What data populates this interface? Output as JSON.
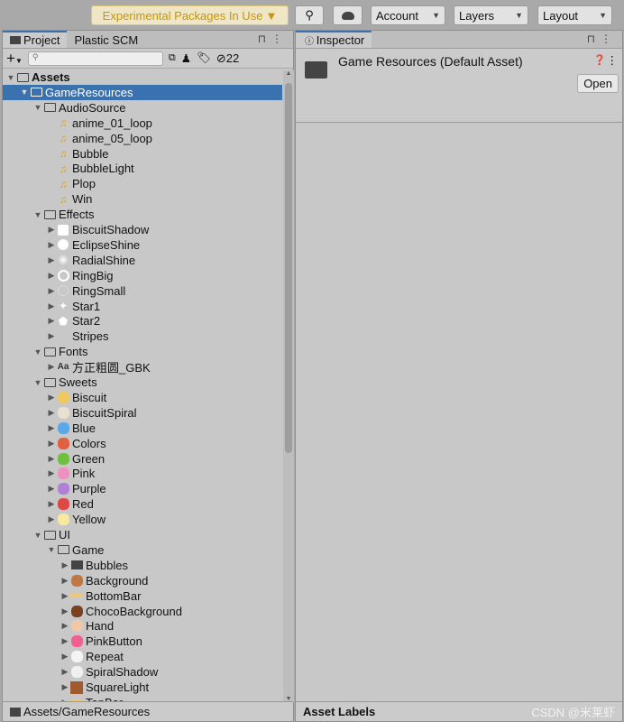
{
  "toolbar": {
    "experimental": "Experimental Packages In Use",
    "account": "Account",
    "layers": "Layers",
    "layout": "Layout"
  },
  "project": {
    "tabs": [
      "Project",
      "Plastic SCM"
    ],
    "hidden_count": "22",
    "path": "Assets/GameResources",
    "tree": [
      {
        "label": "Assets",
        "level": 0,
        "arrow": "open",
        "icon": "folder",
        "bold": true
      },
      {
        "label": "GameResources",
        "level": 1,
        "arrow": "open",
        "icon": "folder",
        "selected": true
      },
      {
        "label": "AudioSource",
        "level": 2,
        "arrow": "open",
        "icon": "folder"
      },
      {
        "label": "anime_01_loop",
        "level": 3,
        "arrow": "none",
        "icon": "audio"
      },
      {
        "label": "anime_05_loop",
        "level": 3,
        "arrow": "none",
        "icon": "audio"
      },
      {
        "label": "Bubble",
        "level": 3,
        "arrow": "none",
        "icon": "audio"
      },
      {
        "label": "BubbleLight",
        "level": 3,
        "arrow": "none",
        "icon": "audio"
      },
      {
        "label": "Plop",
        "level": 3,
        "arrow": "none",
        "icon": "audio"
      },
      {
        "label": "Win",
        "level": 3,
        "arrow": "none",
        "icon": "audio"
      },
      {
        "label": "Effects",
        "level": 2,
        "arrow": "open",
        "icon": "folder"
      },
      {
        "label": "BiscuitShadow",
        "level": 3,
        "arrow": "closed",
        "icon": "sprite-square"
      },
      {
        "label": "EclipseShine",
        "level": 3,
        "arrow": "closed",
        "icon": "sprite-circle"
      },
      {
        "label": "RadialShine",
        "level": 3,
        "arrow": "closed",
        "icon": "sprite-glow"
      },
      {
        "label": "RingBig",
        "level": 3,
        "arrow": "closed",
        "icon": "sprite-ring"
      },
      {
        "label": "RingSmall",
        "level": 3,
        "arrow": "closed",
        "icon": "sprite-faint"
      },
      {
        "label": "Star1",
        "level": 3,
        "arrow": "closed",
        "icon": "sprite-star"
      },
      {
        "label": "Star2",
        "level": 3,
        "arrow": "closed",
        "icon": "sprite-pentagon"
      },
      {
        "label": "Stripes",
        "level": 3,
        "arrow": "closed",
        "icon": "sprite-blank"
      },
      {
        "label": "Fonts",
        "level": 2,
        "arrow": "open",
        "icon": "folder"
      },
      {
        "label": "方正粗圆_GBK",
        "level": 3,
        "arrow": "closed",
        "icon": "font"
      },
      {
        "label": "Sweets",
        "level": 2,
        "arrow": "open",
        "icon": "folder"
      },
      {
        "label": "Biscuit",
        "level": 3,
        "arrow": "closed",
        "icon": "sweet",
        "color": "#f0c860"
      },
      {
        "label": "BiscuitSpiral",
        "level": 3,
        "arrow": "closed",
        "icon": "sweet",
        "color": "#e8e0d0"
      },
      {
        "label": "Blue",
        "level": 3,
        "arrow": "closed",
        "icon": "sweet",
        "color": "#5aa8e8"
      },
      {
        "label": "Colors",
        "level": 3,
        "arrow": "closed",
        "icon": "sweet",
        "color": "#e06040"
      },
      {
        "label": "Green",
        "level": 3,
        "arrow": "closed",
        "icon": "sweet",
        "color": "#70c040"
      },
      {
        "label": "Pink",
        "level": 3,
        "arrow": "closed",
        "icon": "sweet",
        "color": "#f090c0"
      },
      {
        "label": "Purple",
        "level": 3,
        "arrow": "closed",
        "icon": "sweet",
        "color": "#b080d8"
      },
      {
        "label": "Red",
        "level": 3,
        "arrow": "closed",
        "icon": "sweet",
        "color": "#e04848"
      },
      {
        "label": "Yellow",
        "level": 3,
        "arrow": "closed",
        "icon": "sweet",
        "color": "#f8e8a0"
      },
      {
        "label": "UI",
        "level": 2,
        "arrow": "open",
        "icon": "folder"
      },
      {
        "label": "Game",
        "level": 3,
        "arrow": "open",
        "icon": "folder"
      },
      {
        "label": "Bubbles",
        "level": 4,
        "arrow": "closed",
        "icon": "folder-closed"
      },
      {
        "label": "Background",
        "level": 4,
        "arrow": "closed",
        "icon": "sweet",
        "color": "#c07840"
      },
      {
        "label": "BottomBar",
        "level": 4,
        "arrow": "closed",
        "icon": "bar",
        "color": "#f0c878"
      },
      {
        "label": "ChocoBackground",
        "level": 4,
        "arrow": "closed",
        "icon": "sweet",
        "color": "#7a4020"
      },
      {
        "label": "Hand",
        "level": 4,
        "arrow": "closed",
        "icon": "sweet",
        "color": "#f0c8a8"
      },
      {
        "label": "PinkButton",
        "level": 4,
        "arrow": "closed",
        "icon": "sweet",
        "color": "#f06090"
      },
      {
        "label": "Repeat",
        "level": 4,
        "arrow": "closed",
        "icon": "sweet",
        "color": "#f4f4f4"
      },
      {
        "label": "SpiralShadow",
        "level": 4,
        "arrow": "closed",
        "icon": "sweet",
        "color": "#f0f0f0"
      },
      {
        "label": "SquareLight",
        "level": 4,
        "arrow": "closed",
        "icon": "square",
        "color": "#a05a30"
      },
      {
        "label": "TopBar",
        "level": 4,
        "arrow": "closed",
        "icon": "bar",
        "color": "#f0c878"
      }
    ]
  },
  "inspector": {
    "tab": "Inspector",
    "title": "Game Resources (Default Asset)",
    "open": "Open",
    "labels": "Asset Labels"
  },
  "colors": {
    "selection": "#3a72b0",
    "audio": "#d9a520",
    "experimental": "#c8950a"
  },
  "watermark": "CSDN @米莱虾"
}
